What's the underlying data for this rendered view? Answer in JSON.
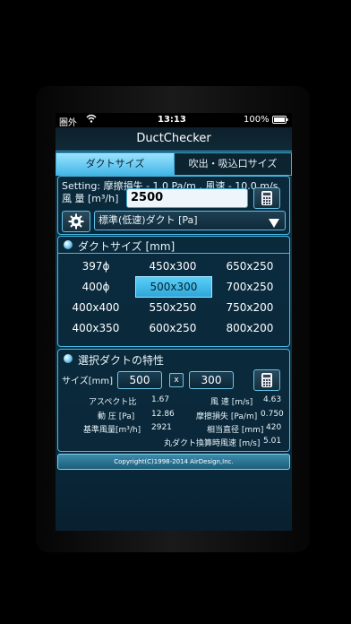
{
  "status": {
    "carrier": "圏外",
    "time": "13:13",
    "battery": "100%"
  },
  "app_title": "DuctChecker",
  "tabs": [
    {
      "label": "ダクトサイズ",
      "active": true
    },
    {
      "label": "吹出・吸込口サイズ",
      "active": false
    }
  ],
  "setting_line": "Setting: 摩擦損失 - 1.0 Pa/m , 風速 - 10.0 m/s",
  "airflow": {
    "label": "風 量 [m³/h]",
    "value": "2500"
  },
  "duct_type": {
    "selected": "標準(低速)ダクト [Pa]"
  },
  "duct_size_section": {
    "title": "ダクトサイズ [mm]"
  },
  "duct_sizes": [
    {
      "label": "397ϕ",
      "selected": false
    },
    {
      "label": "450x300",
      "selected": false
    },
    {
      "label": "650x250",
      "selected": false
    },
    {
      "label": "400ϕ",
      "selected": false
    },
    {
      "label": "500x300",
      "selected": true
    },
    {
      "label": "700x250",
      "selected": false
    },
    {
      "label": "400x400",
      "selected": false
    },
    {
      "label": "550x250",
      "selected": false
    },
    {
      "label": "750x200",
      "selected": false
    },
    {
      "label": "400x350",
      "selected": false
    },
    {
      "label": "600x250",
      "selected": false
    },
    {
      "label": "800x200",
      "selected": false
    }
  ],
  "selected_section": {
    "title": "選択ダクトの特性",
    "size_label": "サイズ[mm]",
    "width": "500",
    "x": "x",
    "height": "300"
  },
  "properties": {
    "aspect_label": "アスペクト比",
    "aspect_value": "1.67",
    "velocity_label": "風 速 [m/s]",
    "velocity_value": "4.63",
    "pressure_label": "動 圧 [Pa]",
    "pressure_value": "12.86",
    "friction_label": "摩擦損失 [Pa/m]",
    "friction_value": "0.750",
    "base_airflow_label": "基準風量[m³/h]",
    "base_airflow_value": "2921",
    "equiv_diameter_label": "相当直径 [mm]",
    "equiv_diameter_value": "420",
    "round_velocity_label": "丸ダクト換算時風速 [m/s]",
    "round_velocity_value": "5.01"
  },
  "copyright": "Copyright(C)1998-2014 AirDesign,Inc.",
  "colors": {
    "accent": "#45b6e6",
    "selected_cell": "#2ea6d8",
    "background": "#0d3b52"
  }
}
